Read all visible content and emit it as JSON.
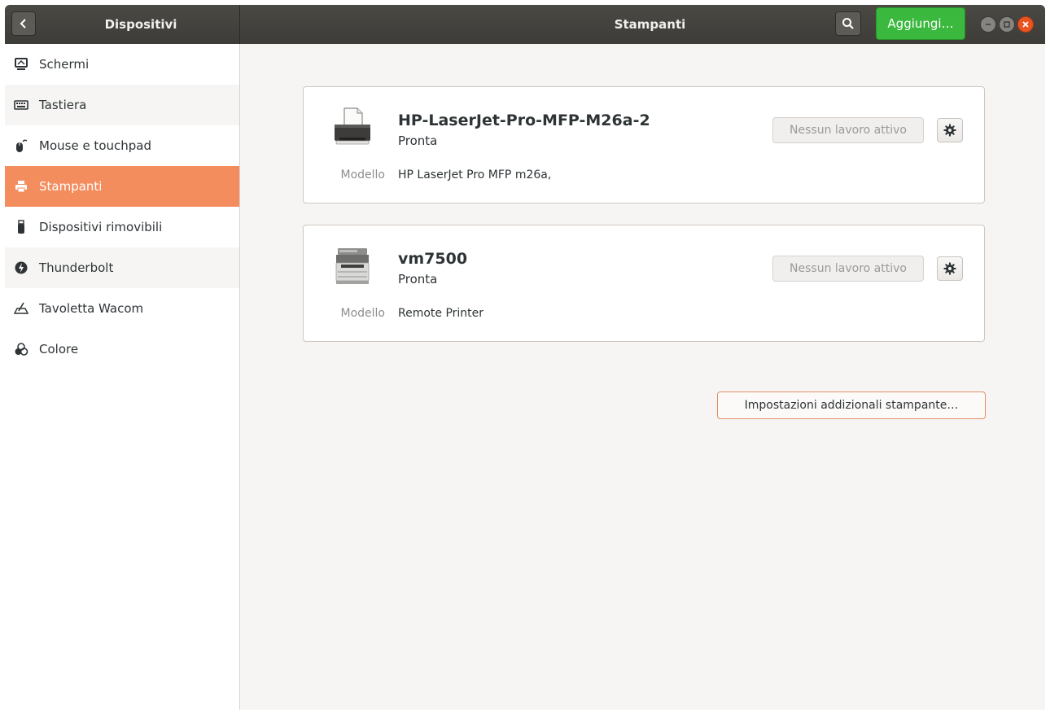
{
  "header": {
    "sidebar_title": "Dispositivi",
    "title": "Stampanti",
    "add_label": "Aggiungi…",
    "back_icon": "chevron-left-icon",
    "search_icon": "search-icon"
  },
  "sidebar": {
    "items": [
      {
        "label": "Schermi",
        "icon": "display-icon"
      },
      {
        "label": "Tastiera",
        "icon": "keyboard-icon"
      },
      {
        "label": "Mouse e touchpad",
        "icon": "mouse-icon"
      },
      {
        "label": "Stampanti",
        "icon": "printer-icon",
        "selected": true
      },
      {
        "label": "Dispositivi rimovibili",
        "icon": "usb-drive-icon"
      },
      {
        "label": "Thunderbolt",
        "icon": "thunderbolt-icon"
      },
      {
        "label": "Tavoletta Wacom",
        "icon": "tablet-icon"
      },
      {
        "label": "Colore",
        "icon": "color-icon"
      }
    ]
  },
  "printers": [
    {
      "name": "HP-LaserJet-Pro-MFP-M26a-2",
      "status": "Pronta",
      "model_label": "Modello",
      "model": "HP LaserJet Pro MFP m26a,",
      "jobs_label": "Nessun lavoro attivo"
    },
    {
      "name": "vm7500",
      "status": "Pronta",
      "model_label": "Modello",
      "model": "Remote Printer",
      "jobs_label": "Nessun lavoro attivo"
    }
  ],
  "additional_settings_label": "Impostazioni addizionali stampante…",
  "colors": {
    "accent": "#f48d5e",
    "add_button": "#3bb83e",
    "close_button": "#e95420"
  }
}
